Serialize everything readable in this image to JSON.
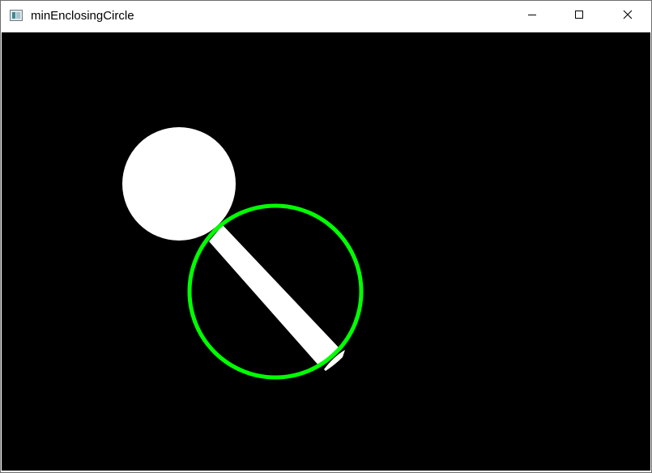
{
  "window": {
    "title": "minEnclosingCircle",
    "controls": {
      "minimize_icon": "minimize-icon",
      "maximize_icon": "maximize-icon",
      "close_icon": "close-icon"
    }
  },
  "canvas": {
    "background": "#000000",
    "shape_color": "#ffffff",
    "circle_color": "#00ff00"
  }
}
